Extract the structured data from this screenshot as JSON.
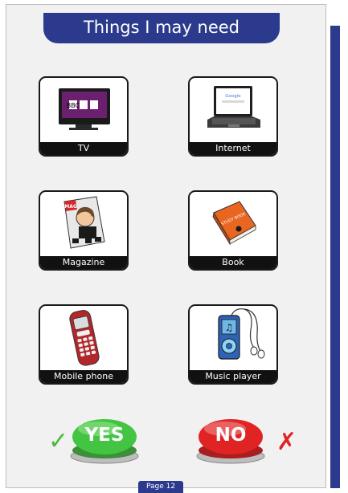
{
  "title": "Things I may need",
  "items": [
    {
      "label": "TV",
      "icon": "tv-icon",
      "brand_text": "BBC"
    },
    {
      "label": "Internet",
      "icon": "laptop-icon",
      "screen_text": "Google"
    },
    {
      "label": "Magazine",
      "icon": "magazine-icon",
      "cover_text": "MAG"
    },
    {
      "label": "Book",
      "icon": "book-icon",
      "cover_text": "STUDY BOOK"
    },
    {
      "label": "Mobile phone",
      "icon": "mobile-phone-icon"
    },
    {
      "label": "Music player",
      "icon": "music-player-icon"
    }
  ],
  "answers": {
    "yes_label": "YES",
    "no_label": "NO",
    "yes_mark": "✓",
    "no_mark": "✗"
  },
  "page_label": "Page 12",
  "colors": {
    "brand": "#2b3a8c",
    "yes": "#2fbf2f",
    "no": "#e02424",
    "panel": "#f1f1f1"
  }
}
